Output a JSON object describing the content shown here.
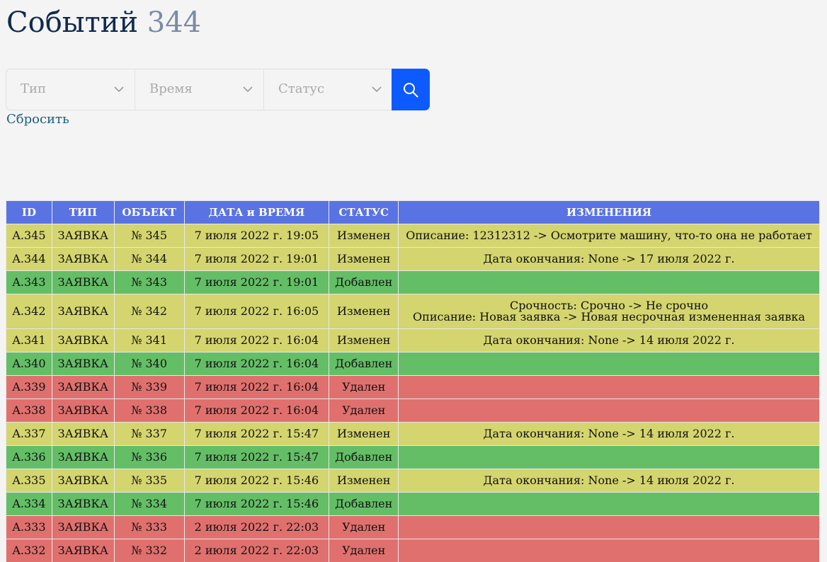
{
  "header": {
    "title": "Событий",
    "count": "344"
  },
  "filters": {
    "type_placeholder": "Тип",
    "time_placeholder": "Время",
    "status_placeholder": "Статус",
    "search_icon": "search-icon",
    "chevron_icon": "chevron-down-icon",
    "accent_color": "#0d5bff"
  },
  "reset": {
    "label": "Сбросить"
  },
  "table": {
    "header_color": "#5a73e3",
    "status_colors": {
      "Изменен": "#d4d56e",
      "Добавлен": "#64be66",
      "Удален": "#e0706e"
    },
    "columns": [
      "ID",
      "ТИП",
      "ОБЪЕКТ",
      "ДАТА и ВРЕМЯ",
      "СТАТУС",
      "ИЗМЕНЕНИЯ"
    ],
    "rows": [
      {
        "id": "A.345",
        "type": "ЗАЯВКА",
        "object": "№ 345",
        "datetime": "7 июля 2022 г. 19:05",
        "status": "Изменен",
        "changes": [
          "Описание: 12312312 -> Осмотрите машину, что-то она не работает"
        ]
      },
      {
        "id": "A.344",
        "type": "ЗАЯВКА",
        "object": "№ 344",
        "datetime": "7 июля 2022 г. 19:01",
        "status": "Изменен",
        "changes": [
          "Дата окончания: None -> 17 июля 2022 г."
        ]
      },
      {
        "id": "A.343",
        "type": "ЗАЯВКА",
        "object": "№ 343",
        "datetime": "7 июля 2022 г. 19:01",
        "status": "Добавлен",
        "changes": []
      },
      {
        "id": "A.342",
        "type": "ЗАЯВКА",
        "object": "№ 342",
        "datetime": "7 июля 2022 г. 16:05",
        "status": "Изменен",
        "changes": [
          "Срочность: Срочно -> Не срочно",
          "Описание: Новая заявка -> Новая несрочная измененная заявка"
        ]
      },
      {
        "id": "A.341",
        "type": "ЗАЯВКА",
        "object": "№ 341",
        "datetime": "7 июля 2022 г. 16:04",
        "status": "Изменен",
        "changes": [
          "Дата окончания: None -> 14 июля 2022 г."
        ]
      },
      {
        "id": "A.340",
        "type": "ЗАЯВКА",
        "object": "№ 340",
        "datetime": "7 июля 2022 г. 16:04",
        "status": "Добавлен",
        "changes": []
      },
      {
        "id": "A.339",
        "type": "ЗАЯВКА",
        "object": "№ 339",
        "datetime": "7 июля 2022 г. 16:04",
        "status": "Удален",
        "changes": []
      },
      {
        "id": "A.338",
        "type": "ЗАЯВКА",
        "object": "№ 338",
        "datetime": "7 июля 2022 г. 16:04",
        "status": "Удален",
        "changes": []
      },
      {
        "id": "A.337",
        "type": "ЗАЯВКА",
        "object": "№ 337",
        "datetime": "7 июля 2022 г. 15:47",
        "status": "Изменен",
        "changes": [
          "Дата окончания: None -> 14 июля 2022 г."
        ]
      },
      {
        "id": "A.336",
        "type": "ЗАЯВКА",
        "object": "№ 336",
        "datetime": "7 июля 2022 г. 15:47",
        "status": "Добавлен",
        "changes": []
      },
      {
        "id": "A.335",
        "type": "ЗАЯВКА",
        "object": "№ 335",
        "datetime": "7 июля 2022 г. 15:46",
        "status": "Изменен",
        "changes": [
          "Дата окончания: None -> 14 июля 2022 г."
        ]
      },
      {
        "id": "A.334",
        "type": "ЗАЯВКА",
        "object": "№ 334",
        "datetime": "7 июля 2022 г. 15:46",
        "status": "Добавлен",
        "changes": []
      },
      {
        "id": "A.333",
        "type": "ЗАЯВКА",
        "object": "№ 333",
        "datetime": "2 июля 2022 г. 22:03",
        "status": "Удален",
        "changes": []
      },
      {
        "id": "A.332",
        "type": "ЗАЯВКА",
        "object": "№ 332",
        "datetime": "2 июля 2022 г. 22:03",
        "status": "Удален",
        "changes": []
      }
    ]
  }
}
